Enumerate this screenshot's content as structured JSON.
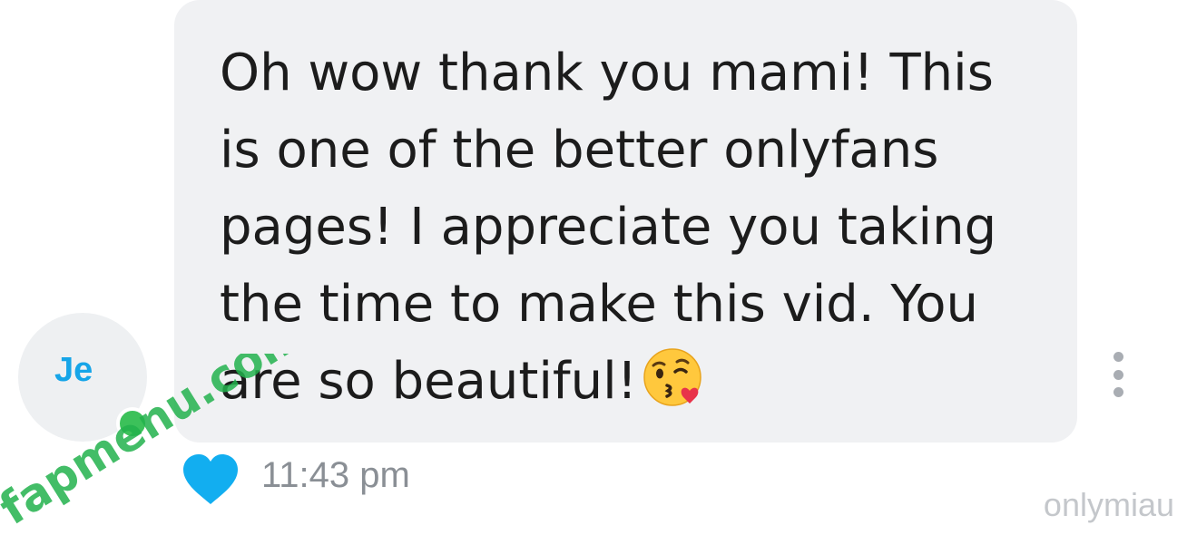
{
  "sender": {
    "avatar_initials": "Je",
    "online": true
  },
  "message": {
    "text": "Oh wow thank you mami! This is one of the better onlyfans pages! I appreciate you taking the time to make this vid. You are so beautiful!",
    "emoji": "kissing-face-with-heart-emoji",
    "timestamp": "11:43 pm",
    "liked": true
  },
  "icons": {
    "more": "more-vertical-icon",
    "like": "heart-icon"
  },
  "colors": {
    "bubble_bg": "#f0f1f3",
    "avatar_initials": "#16a5e8",
    "online": "#3cc15a",
    "heart": "#12aef0",
    "timestamp": "#8a8f95",
    "watermark_brand": "#22b14c"
  },
  "watermarks": {
    "brand": "fapmenu.com",
    "username": "onlymiau"
  }
}
